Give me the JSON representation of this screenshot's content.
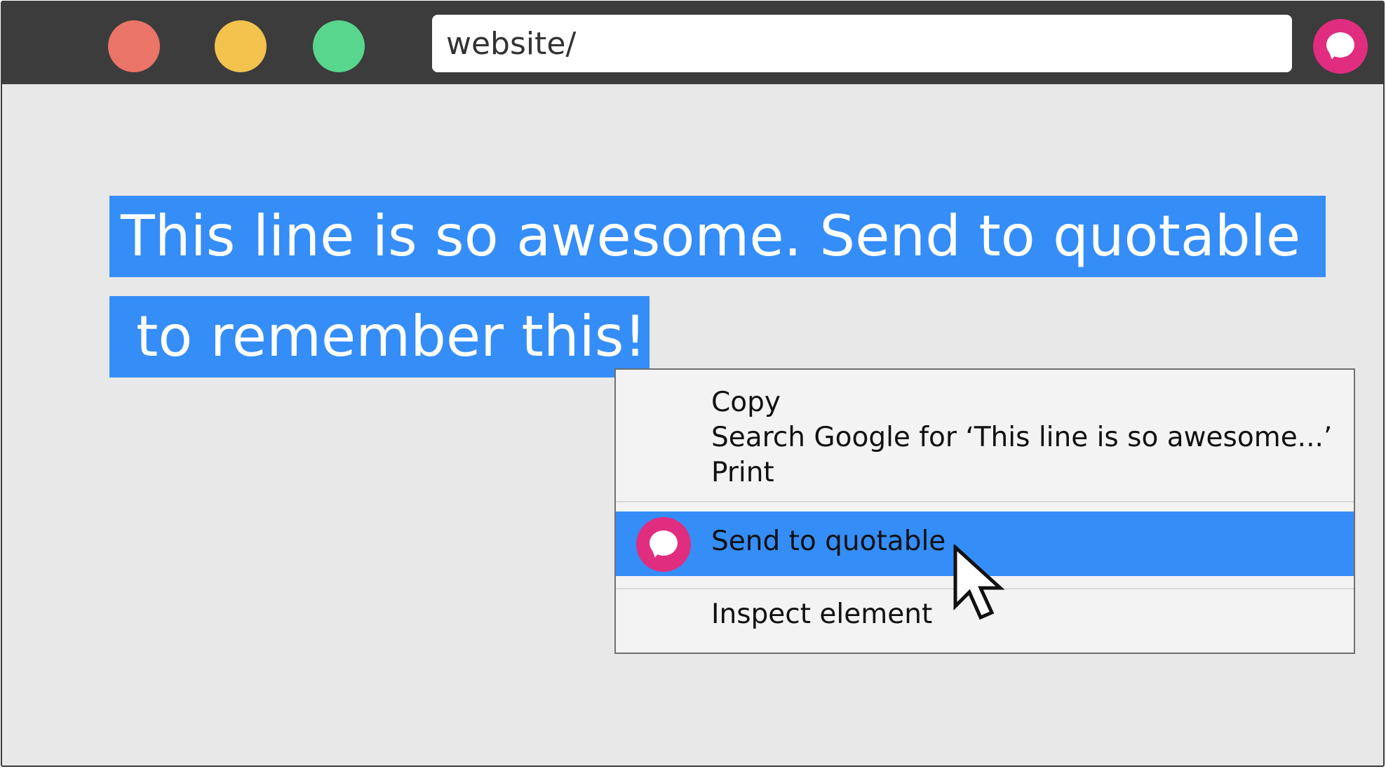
{
  "browser": {
    "url": "website/",
    "traffic_lights": [
      "close-dot",
      "minimize-dot",
      "maximize-dot"
    ],
    "colors": {
      "red": "#e97467",
      "yellow": "#f3c34d",
      "green": "#58d68d",
      "brand": "#e02d7f",
      "selection": "#358df8"
    }
  },
  "page": {
    "selected_text_line1": "This line is so awesome. Send to quotable",
    "selected_text_line2": "to remember this!"
  },
  "context_menu": {
    "copy": "Copy",
    "search": "Search Google for ‘This line is so awesome...’",
    "print": "Print",
    "send": "Send to quotable",
    "inspect": "Inspect element"
  },
  "icons": {
    "extension": "quotable-chat-bubble-icon",
    "cursor": "mouse-pointer-icon"
  }
}
